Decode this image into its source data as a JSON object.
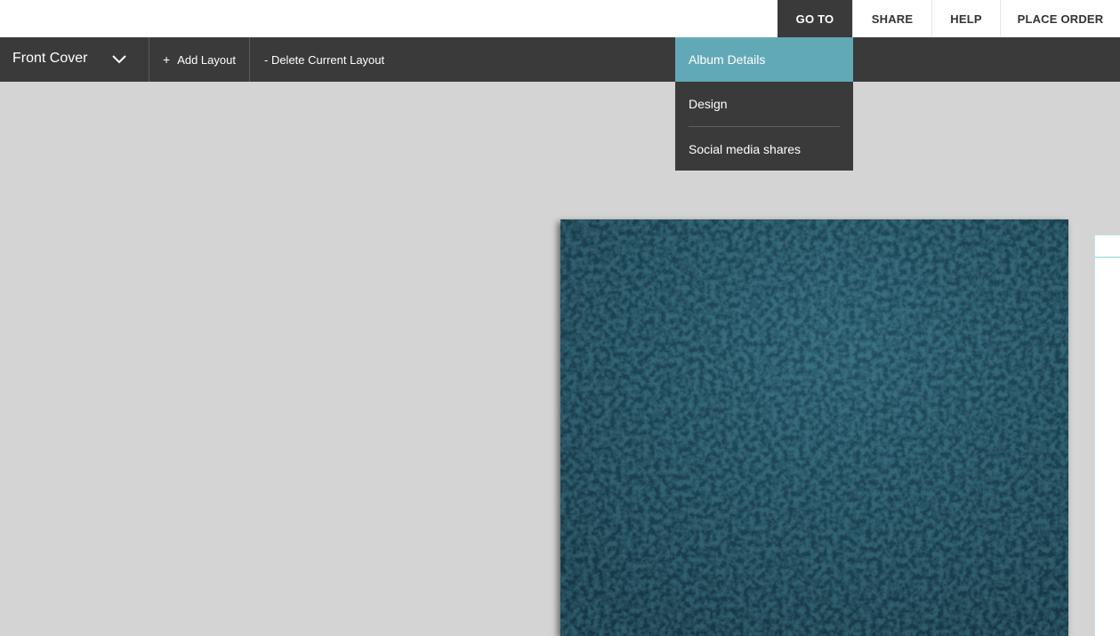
{
  "top_nav": {
    "items": [
      {
        "label": "GO TO",
        "active": true
      },
      {
        "label": "SHARE",
        "active": false
      },
      {
        "label": "HELP",
        "active": false
      },
      {
        "label": "PLACE ORDER",
        "active": false
      }
    ]
  },
  "toolbar": {
    "layout_select": {
      "value": "Front Cover",
      "icon": "chevron-down-icon"
    },
    "add_layout_label": "Add Layout",
    "add_layout_icon": "+",
    "delete_layout_label": "- Delete Current Layout"
  },
  "goto_menu": {
    "items": [
      {
        "label": "Album Details",
        "highlighted": true
      },
      {
        "label": "Design",
        "highlighted": false
      },
      {
        "label": "Social media shares",
        "highlighted": false
      }
    ]
  },
  "colors": {
    "toolbar_bg": "#3a3a3a",
    "canvas_bg": "#d4d4d4",
    "menu_highlight": "#62a9b7",
    "cover_texture": "#1f4656"
  }
}
